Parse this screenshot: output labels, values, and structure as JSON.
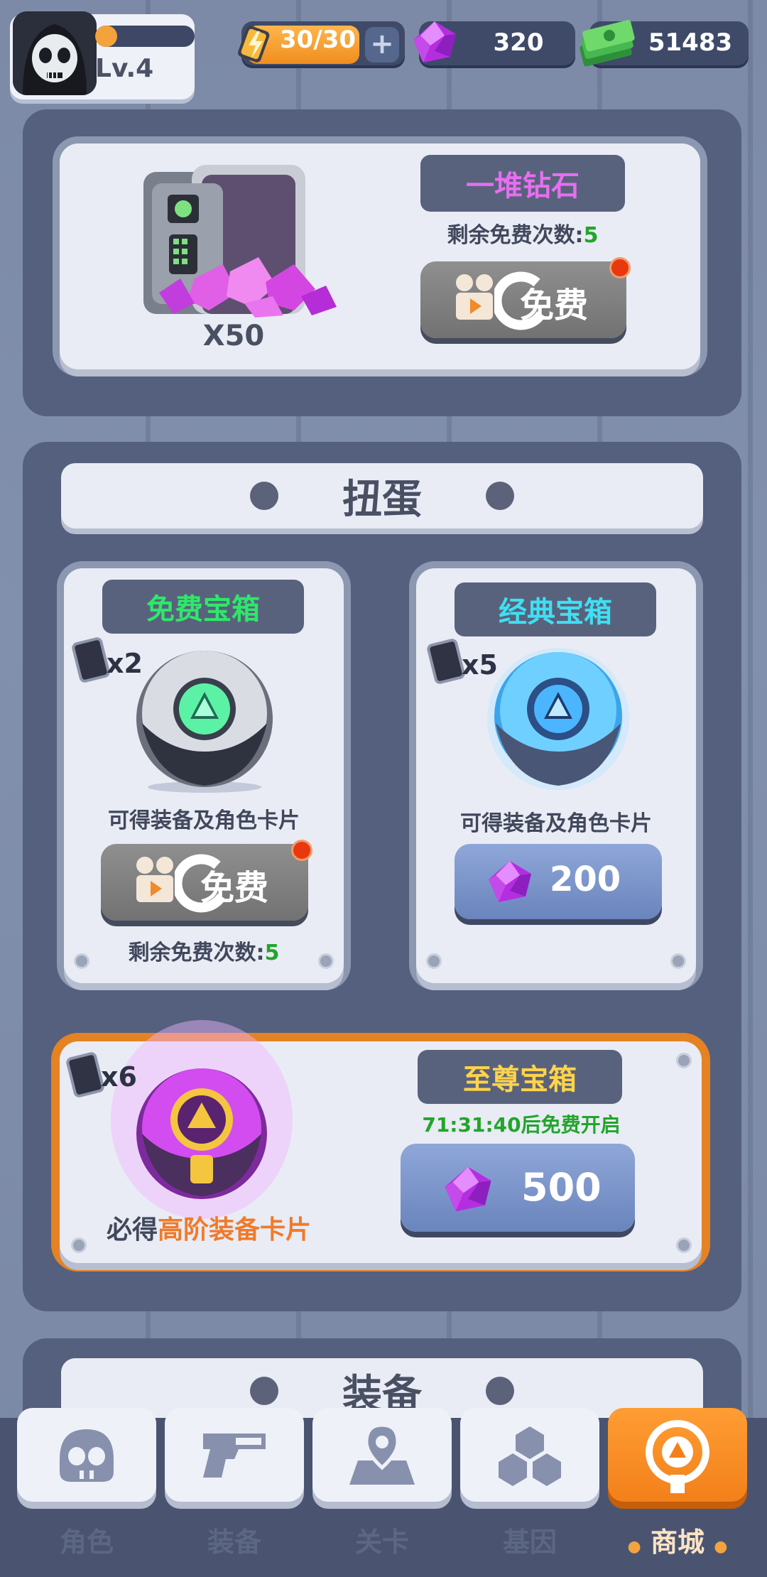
{
  "header": {
    "level": "Lv.4",
    "xp_progress": 0.22,
    "energy": "30/30",
    "energy_plus": "+",
    "gems": "320",
    "cash": "51483"
  },
  "diamond_offer": {
    "title": "一堆钻石",
    "remaining_prefix": "剩余免费次数:",
    "remaining_count": "5",
    "amount": "X50",
    "free_label": "免费"
  },
  "gacha": {
    "section_title": "扭蛋",
    "free_box": {
      "title": "免费宝箱",
      "card_count": "x2",
      "desc": "可得装备及角色卡片",
      "button_label": "免费",
      "remaining_prefix": "剩余免费次数:",
      "remaining_count": "5"
    },
    "classic_box": {
      "title": "经典宝箱",
      "card_count": "x5",
      "desc": "可得装备及角色卡片",
      "price": "200"
    },
    "supreme_box": {
      "title": "至尊宝箱",
      "card_count": "x6",
      "timer": "71:31:40后免费开启",
      "desc_prefix": "必得",
      "desc_highlight": "高阶装备卡片",
      "price": "500"
    }
  },
  "equipment_section_title": "装备",
  "nav": {
    "items": [
      {
        "label": "角色",
        "icon": "skull-icon"
      },
      {
        "label": "装备",
        "icon": "gun-icon"
      },
      {
        "label": "关卡",
        "icon": "map-pin-icon"
      },
      {
        "label": "基因",
        "icon": "hexagons-icon"
      },
      {
        "label": "商城",
        "icon": "shop-icon"
      }
    ],
    "active_index": 4
  },
  "colors": {
    "accent_orange": "#f3801a",
    "gem_purple": "#c23be6",
    "free_green": "#2ee86a",
    "classic_cyan": "#3ee0f2",
    "supreme_yellow": "#ffd34a",
    "highlight_orange": "#f07a2a"
  }
}
